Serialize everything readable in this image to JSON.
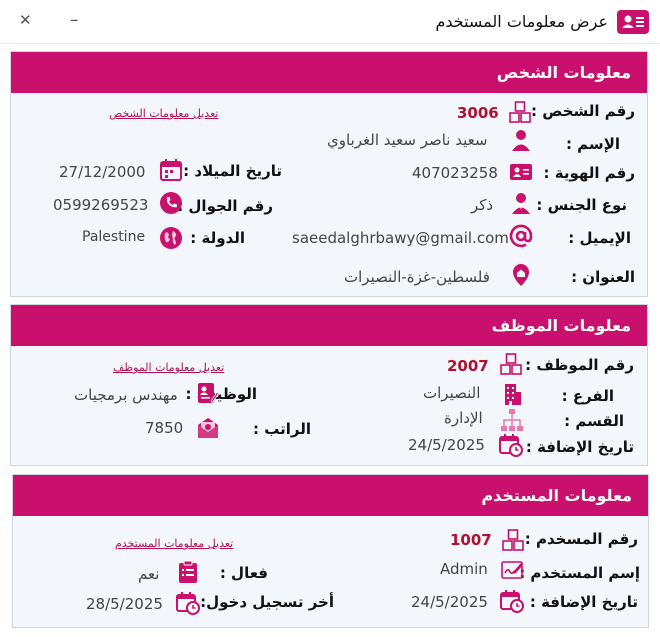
{
  "window": {
    "title": "عرض معلومات المستخدم",
    "minimize_glyph": "–",
    "close_glyph": "✕"
  },
  "colors": {
    "accent": "#c8106c",
    "id_value": "#b01030",
    "section_bg": "#f3f6fa"
  },
  "person": {
    "header": "معلومات الشخص",
    "edit_link": "تعديل معلومات الشخص",
    "person_id_label": "رقم الشخص :",
    "person_id_value": "3006",
    "name_label": "الإسم :",
    "name_value": "سعيد ناصر سعيد الغرباوي",
    "national_id_label": "رقم الهوية :",
    "national_id_value": "407023258",
    "birthdate_label": "تاريخ الميلاد :",
    "birthdate_value": "27/12/2000",
    "gender_label": "نوع الجنس :",
    "gender_value": "ذكر",
    "mobile_label": "رقم الجوال :",
    "mobile_value": "0599269523",
    "email_label": "الإيميل :",
    "email_value": "saeedalghrbawy@gmail.com",
    "country_label": "الدولة :",
    "country_value": "Palestine",
    "address_label": "العنوان :",
    "address_value": "فلسطين-غزة-النصيرات"
  },
  "employee": {
    "header": "معلومات الموظف",
    "edit_link": "تعديل معلومات الموظف",
    "employee_id_label": "رقم الموظف :",
    "employee_id_value": "2007",
    "job_label": "الوظيفة :",
    "job_value": "مهندس برمجيات",
    "branch_label": "الفرع :",
    "branch_value": "النصيرات",
    "department_label": "القسم :",
    "department_value": "الإدارة",
    "salary_label": "الراتب :",
    "salary_value": "7850",
    "added_label": "تاريخ الإضافة :",
    "added_value": "24/5/2025"
  },
  "user": {
    "header": "معلومات المستخدم",
    "edit_link": "تعديل معلومات المستخدم",
    "user_id_label": "رقم المسخدم :",
    "user_id_value": "1007",
    "username_label": "إسم المستخدم :",
    "username_value": "Admin",
    "active_label": "فعال :",
    "active_value": "نعم",
    "added_label": "تاريخ الإضافة :",
    "added_value": "24/5/2025",
    "last_login_label": "أخر تسجيل دخول:",
    "last_login_value": "28/5/2025"
  }
}
